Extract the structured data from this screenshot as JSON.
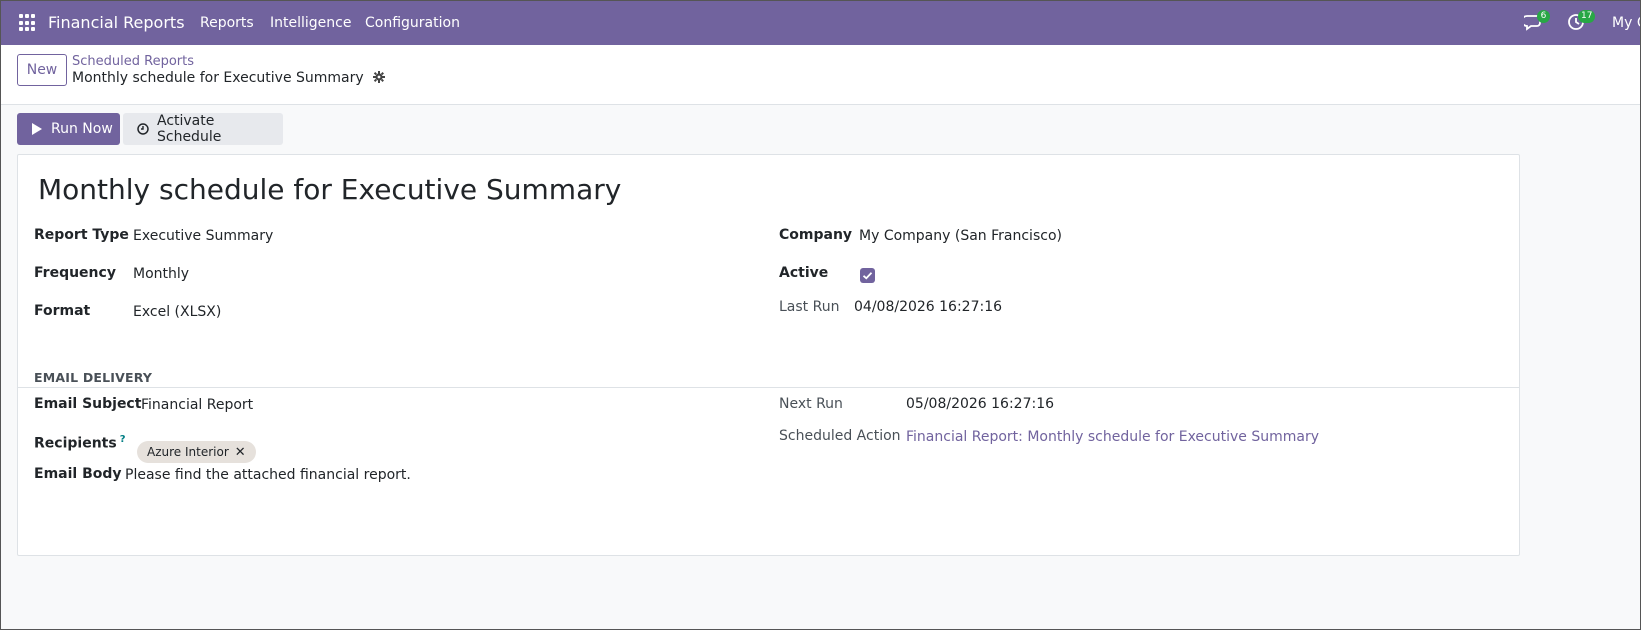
{
  "navbar": {
    "brand": "Financial Reports",
    "menu": [
      "Reports",
      "Intelligence",
      "Configuration"
    ],
    "messages_count": "6",
    "activities_count": "17",
    "user_label": "My C",
    "color": "#71639e"
  },
  "control_panel": {
    "new_button": "New",
    "breadcrumb_parent": "Scheduled Reports",
    "breadcrumb_current": "Monthly schedule for Executive Summary"
  },
  "actions": {
    "run_now": "Run Now",
    "activate_schedule": "Activate Schedule"
  },
  "form": {
    "title": "Monthly schedule for Executive Summary",
    "report_type_label": "Report Type",
    "report_type_value": "Executive Summary",
    "frequency_label": "Frequency",
    "frequency_value": "Monthly",
    "format_label": "Format",
    "format_value": "Excel (XLSX)",
    "company_label": "Company",
    "company_value": "My Company (San Francisco)",
    "active_label": "Active",
    "active_checked": true,
    "last_run_label": "Last Run",
    "last_run_value": "04/08/2026 16:27:16",
    "email_section_title": "EMAIL DELIVERY",
    "email_subject_label": "Email Subject",
    "email_subject_value": "Financial Report",
    "recipients_label": "Recipients",
    "recipients_help": "?",
    "recipients": [
      "Azure Interior"
    ],
    "email_body_label": "Email Body",
    "email_body_value": "Please find the attached financial report.",
    "next_run_label": "Next Run",
    "next_run_value": "05/08/2026 16:27:16",
    "scheduled_action_label": "Scheduled Action",
    "scheduled_action_value": "Financial Report: Monthly schedule for Executive Summary"
  }
}
